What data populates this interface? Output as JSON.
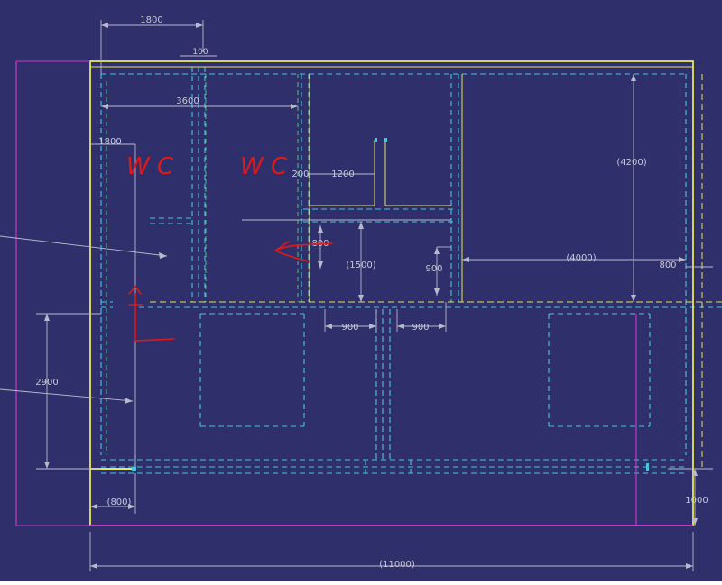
{
  "colors": {
    "background": "#2f2f6b",
    "wall": "#e6e65a",
    "hidden": "#48c6dc",
    "dimension": "#b9b9cc",
    "dim_text": "#c8c8d8",
    "accent": "#c638c6",
    "annotation": "#e01818",
    "dashed_green": "#58c070"
  },
  "dims": {
    "d1800_top": "1800",
    "d100": "100",
    "d3600": "3600",
    "d1800_left": "1800",
    "d200": "200",
    "d1200": "1200",
    "d4200": "(4200)",
    "d800_mid": "800",
    "d1500": "(1500)",
    "d900_v": "900",
    "d4000": "(4000)",
    "d800_right": "800",
    "d900_a": "900",
    "d900_b": "900",
    "d2900": "2900",
    "d800_bottom": "(800)",
    "d1000": "1000",
    "d11000": "(11000)"
  },
  "annotations": {
    "wc1": "W C",
    "wc2": "W C"
  }
}
